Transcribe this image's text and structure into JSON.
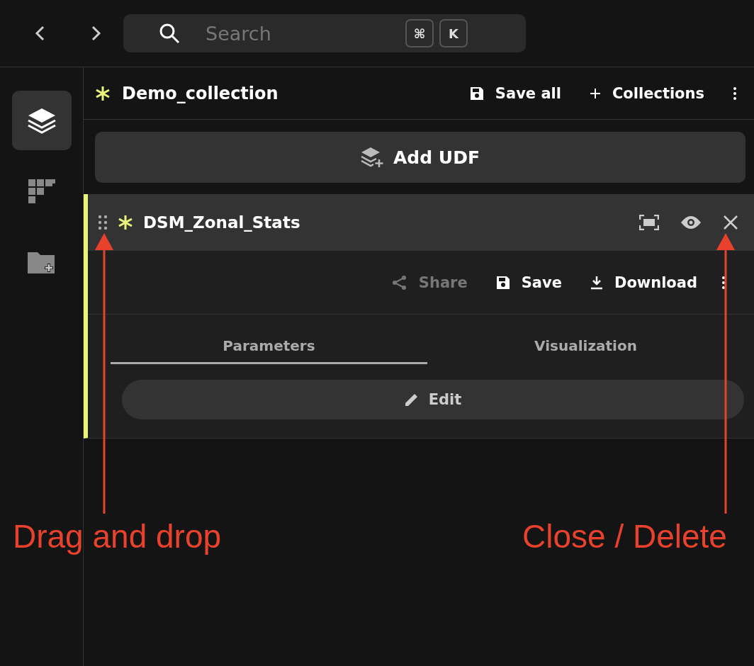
{
  "search": {
    "placeholder": "Search",
    "shortcut": [
      "⌘",
      "K"
    ]
  },
  "sidebar": {
    "items": [
      {
        "kind": "layers",
        "selected": true
      },
      {
        "kind": "blocks",
        "selected": false
      },
      {
        "kind": "folder",
        "selected": false
      }
    ]
  },
  "collection": {
    "title": "Demo_collection",
    "unsaved": true,
    "actions": [
      {
        "kind": "save",
        "label": "Save all"
      },
      {
        "kind": "add",
        "label": "Collections"
      }
    ]
  },
  "add_button": {
    "label": "Add UDF"
  },
  "udf": {
    "name": "DSM_Zonal_Stats",
    "unsaved": true,
    "actions": [
      {
        "kind": "share",
        "label": "Share",
        "disabled": true
      },
      {
        "kind": "save",
        "label": "Save",
        "disabled": false
      },
      {
        "kind": "download",
        "label": "Download",
        "disabled": false
      }
    ],
    "tabs": [
      {
        "label": "Parameters",
        "selected": true
      },
      {
        "label": "Visualization",
        "selected": false
      }
    ],
    "edit_button": {
      "label": "Edit"
    }
  },
  "annotations": [
    {
      "text": "Drag and drop"
    },
    {
      "text": "Close / Delete"
    }
  ]
}
